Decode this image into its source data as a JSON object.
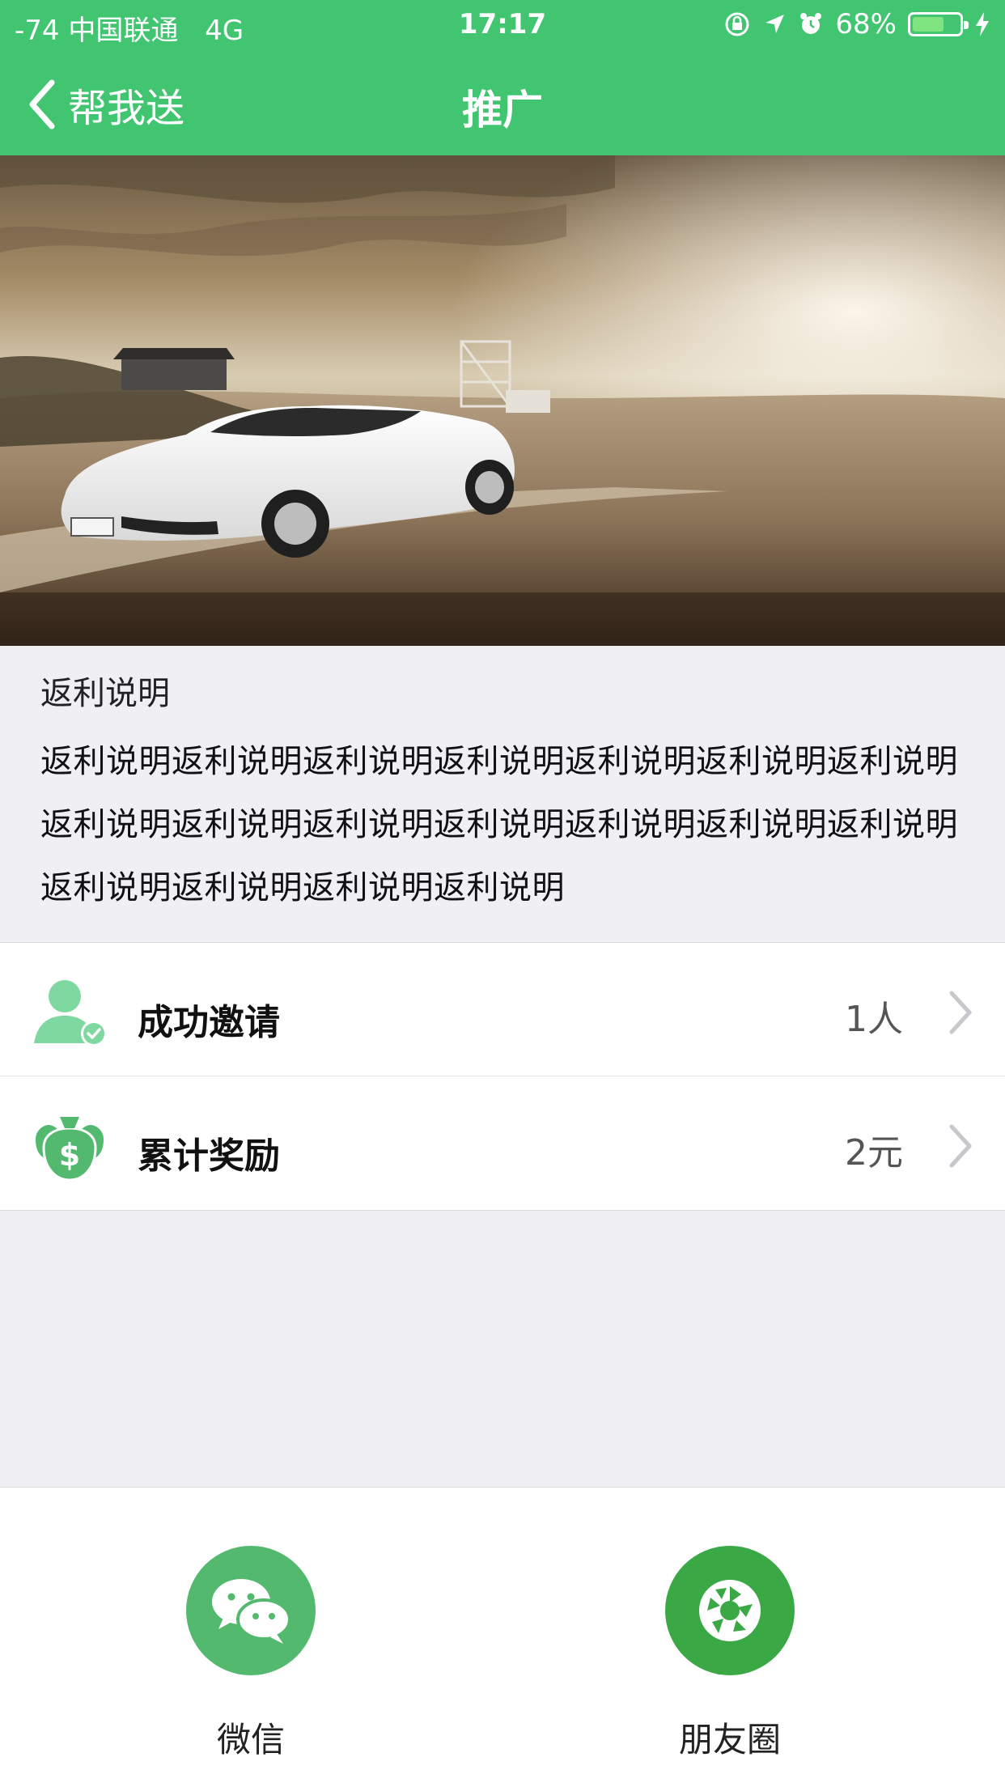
{
  "status_bar": {
    "carrier": "-74 中国联通",
    "network": "4G",
    "time": "17:17",
    "battery": "68%",
    "battery_level": 0.68
  },
  "nav": {
    "back_label": "帮我送",
    "title": "推广"
  },
  "rebate": {
    "title": "返利说明",
    "body": "返利说明返利说明返利说明返利说明返利说明返利说明返利说明返利说明返利说明返利说明返利说明返利说明返利说明返利说明返利说明返利说明返利说明返利说明"
  },
  "rows": [
    {
      "label": "成功邀请",
      "value": "1人",
      "icon": "user-check-icon"
    },
    {
      "label": "累计奖励",
      "value": "2元",
      "icon": "money-bags-icon"
    }
  ],
  "share": {
    "wechat_label": "微信",
    "moments_label": "朋友圈"
  },
  "colors": {
    "brand": "#41c570",
    "wechat": "#52b96e",
    "moments": "#3aa845"
  }
}
